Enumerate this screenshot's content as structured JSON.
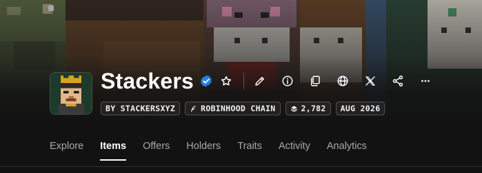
{
  "collection": {
    "name": "Stackers",
    "verified": true,
    "badges": {
      "creator": "BY STACKERSXYZ",
      "chain": "ROBINHOOD CHAIN",
      "items": "2,782",
      "date": "AUG 2026"
    }
  },
  "icons": {
    "verified": "verified-badge-icon",
    "favorite": "star-icon",
    "edit": "pencil-icon",
    "info": "info-icon",
    "copy": "copy-icon",
    "website": "globe-icon",
    "x": "x-logo-icon",
    "share": "share-icon",
    "more": "ellipsis-icon"
  },
  "tabs": [
    {
      "label": "Explore",
      "active": false
    },
    {
      "label": "Items",
      "active": true
    },
    {
      "label": "Offers",
      "active": false
    },
    {
      "label": "Holders",
      "active": false
    },
    {
      "label": "Traits",
      "active": false
    },
    {
      "label": "Activity",
      "active": false
    },
    {
      "label": "Analytics",
      "active": false
    }
  ],
  "colors": {
    "background": "#121212",
    "verified": "#2081e2",
    "text": "#ffffff",
    "muted": "#a9a9a9"
  }
}
